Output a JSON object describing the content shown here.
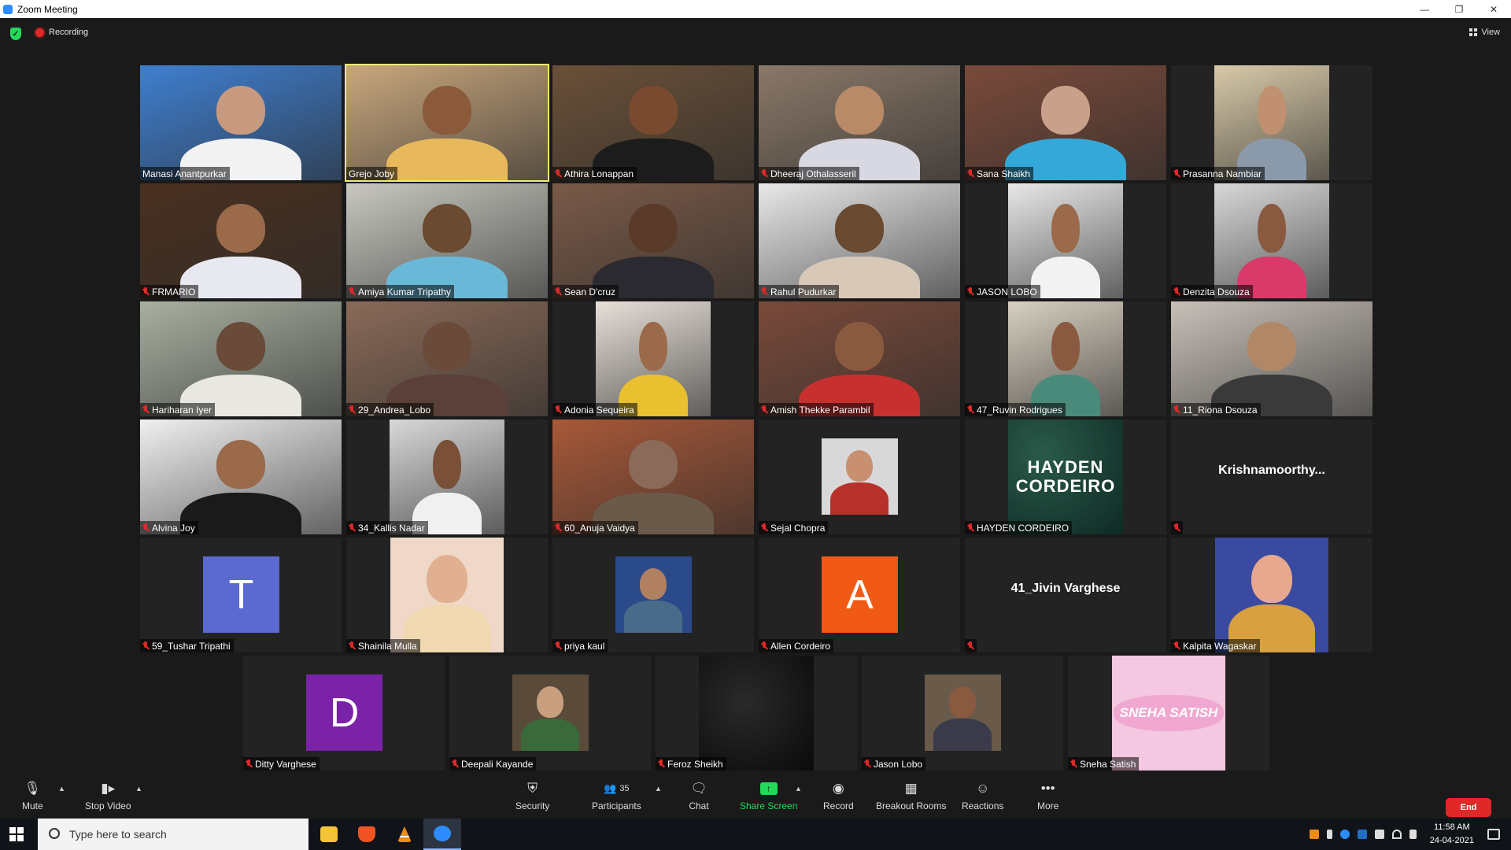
{
  "window": {
    "title": "Zoom Meeting"
  },
  "topbar": {
    "recording_label": "Recording",
    "view_label": "View"
  },
  "participants": [
    {
      "name": "Manasi Anantpurkar",
      "muted": false,
      "bg": "#3f7fd0",
      "skin": "#c79a80",
      "shirt": "#f2f2f2"
    },
    {
      "name": "Grejo Joby",
      "muted": false,
      "active": true,
      "bg": "#c9a77d",
      "skin": "#8a5a3a",
      "shirt": "#e8b85c"
    },
    {
      "name": "Athira Lonappan",
      "muted": true,
      "bg": "#6a5038",
      "skin": "#7a4a30",
      "shirt": "#1c1c1c"
    },
    {
      "name": "Dheeraj Othalasseril",
      "muted": true,
      "bg": "#8a7868",
      "skin": "#b98a68",
      "shirt": "#d8d8e2"
    },
    {
      "name": "Sana Shaikh",
      "muted": true,
      "bg": "#7a4a3a",
      "skin": "#c9a08a",
      "shirt": "#34a8d8"
    },
    {
      "name": "Prasanna Nambiar",
      "muted": true,
      "bg": "#d8c9a8",
      "skin": "#c09070",
      "shirt": "#8a9aaa",
      "narrow": true
    },
    {
      "name": "FRMARIO",
      "muted": true,
      "bg": "#4a3020",
      "skin": "#9a6a4a",
      "shirt": "#e8e8f0"
    },
    {
      "name": "Amiya Kumar Tripathy",
      "muted": true,
      "bg": "#c8c8c0",
      "skin": "#6a4a30",
      "shirt": "#6ab8d8"
    },
    {
      "name": "Sean D'cruz",
      "muted": true,
      "bg": "#7a5a48",
      "skin": "#5a3a28",
      "shirt": "#2a2a30"
    },
    {
      "name": "Rahul Pudurkar",
      "muted": true,
      "bg": "#e8e8e8",
      "skin": "#6a4a30",
      "shirt": "#d8c8b8"
    },
    {
      "name": "JASON LOBO",
      "muted": true,
      "bg": "#e8e8e8",
      "skin": "#9a6a4a",
      "shirt": "#f2f2f2",
      "narrow": true
    },
    {
      "name": "Denzita Dsouza",
      "muted": true,
      "bg": "#d8d8d8",
      "skin": "#8a5a40",
      "shirt": "#d83a6a",
      "narrow": true
    },
    {
      "name": "Hariharan Iyer",
      "muted": true,
      "bg": "#a8b0a0",
      "skin": "#6a4a38",
      "shirt": "#e8e8e0"
    },
    {
      "name": "29_Andrea_Lobo",
      "muted": true,
      "bg": "#8a6a58",
      "skin": "#6a4a38",
      "shirt": "#5a4038"
    },
    {
      "name": "Adonia Sequeira",
      "muted": true,
      "bg": "#e8e0d8",
      "skin": "#9a6a4a",
      "shirt": "#e8c030",
      "narrow": true
    },
    {
      "name": "Amish Thekke Parambil",
      "muted": true,
      "bg": "#7a4a3a",
      "skin": "#8a5a40",
      "shirt": "#c83030"
    },
    {
      "name": "47_Ruvin Rodrigues",
      "muted": true,
      "bg": "#d8d0c0",
      "skin": "#8a5a40",
      "shirt": "#4a8a7a",
      "narrow": true
    },
    {
      "name": "11_Riona Dsouza",
      "muted": true,
      "bg": "#c8c0b8",
      "skin": "#b08868",
      "shirt": "#3a3a3a"
    },
    {
      "name": "Alvina Joy",
      "muted": true,
      "bg": "#f0f0f0",
      "skin": "#9a6a4a",
      "shirt": "#1a1a1a"
    },
    {
      "name": "34_Kallis Nadar",
      "muted": true,
      "bg": "#d8d8d8",
      "skin": "#7a5038",
      "shirt": "#f0f0f0",
      "narrow": true
    },
    {
      "name": "60_Anuja Vaidya",
      "muted": true,
      "bg": "#a85838",
      "skin": "#8a6a58",
      "shirt": "#6a5a4a"
    },
    {
      "name": "Sejal Chopra",
      "muted": true,
      "photo": true,
      "bg": "#d8d8d8",
      "skin": "#c89070",
      "shirt": "#b8302a"
    },
    {
      "name": "HAYDEN CORDEIRO",
      "muted": true,
      "hayden": true
    },
    {
      "name": "",
      "muted": true,
      "display_name": "Krishnamoorthy..."
    },
    {
      "name": "59_Tushar Tripathi",
      "muted": true,
      "letter": "T",
      "letter_bg": "#5a6ad0"
    },
    {
      "name": "Shainila Mulla",
      "muted": true,
      "photo_big": true,
      "bg": "#f0d8c8",
      "skin": "#e0b090",
      "shirt": "#f0d8b0"
    },
    {
      "name": "priya kaul",
      "muted": true,
      "photo": true,
      "bg": "#2a4a8a",
      "skin": "#b08060",
      "shirt": "#4a6a8a"
    },
    {
      "name": "Allen Cordeiro",
      "muted": true,
      "letter": "A",
      "letter_bg": "#f05a14"
    },
    {
      "name": "",
      "muted": true,
      "display_name": "41_Jivin Varghese"
    },
    {
      "name": "Kalpita Wagaskar",
      "muted": true,
      "photo_big": true,
      "bg": "#3a4aa0",
      "skin": "#e8a890",
      "shirt": "#d8a040"
    },
    {
      "name": "Ditty Varghese",
      "muted": true,
      "letter": "D",
      "letter_bg": "#7a22a8"
    },
    {
      "name": "Deepali Kayande",
      "muted": true,
      "photo": true,
      "bg": "#5a4a3a",
      "skin": "#c8a080",
      "shirt": "#3a6a3a"
    },
    {
      "name": "Feroz Sheikh",
      "muted": true,
      "dark": true
    },
    {
      "name": "Jason Lobo",
      "muted": true,
      "photo": true,
      "bg": "#6a5a4a",
      "skin": "#8a5a40",
      "shirt": "#3a3a4a"
    },
    {
      "name": "Sneha Satish",
      "muted": true,
      "sneha": true,
      "logo_text": "SNEHA SATISH"
    }
  ],
  "toolbar": {
    "mute": "Mute",
    "stop_video": "Stop Video",
    "security": "Security",
    "participants": "Participants",
    "participants_count": "35",
    "chat": "Chat",
    "share_screen": "Share Screen",
    "record": "Record",
    "breakout_rooms": "Breakout Rooms",
    "reactions": "Reactions",
    "more": "More",
    "end": "End"
  },
  "taskbar": {
    "search_placeholder": "Type here to search",
    "time": "11:58 AM",
    "date": "24-04-2021"
  },
  "colors": {
    "accent": "#2d8cff",
    "recording": "#e02828",
    "share_green": "#23d959",
    "active_speaker": "#e8f075"
  }
}
